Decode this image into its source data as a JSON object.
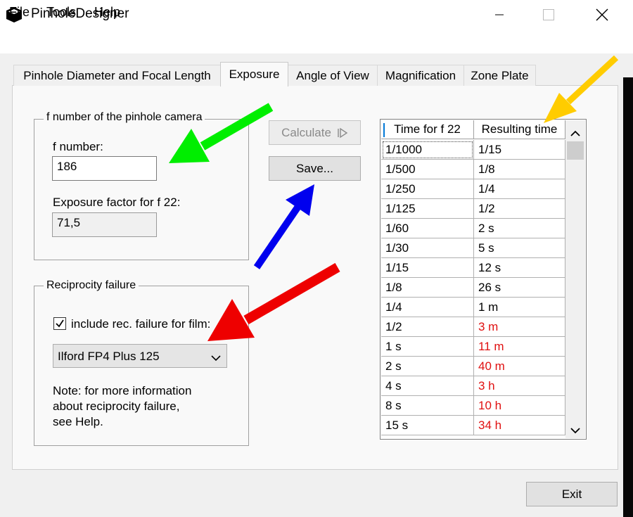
{
  "window": {
    "title": "PinholeDesigner"
  },
  "menu": {
    "file": "File",
    "tools": "Tools",
    "help": "Help"
  },
  "tabs": [
    {
      "label": "Pinhole Diameter and Focal Length"
    },
    {
      "label": "Exposure"
    },
    {
      "label": "Angle of View"
    },
    {
      "label": "Magnification"
    },
    {
      "label": "Zone Plate"
    }
  ],
  "fnumber_group": {
    "legend": "f number of the pinhole camera",
    "fnumber_label": "f number:",
    "fnumber_value": "186",
    "factor_label": "Exposure factor for f 22:",
    "factor_value": "71,5"
  },
  "buttons": {
    "calculate": "Calculate",
    "save": "Save...",
    "exit": "Exit"
  },
  "reciprocity_group": {
    "legend": "Reciprocity failure",
    "checkbox_label": "include rec. failure for film:",
    "checked": true,
    "film_selected": "Ilford FP4 Plus 125",
    "note_line1": "Note: for more information",
    "note_line2": "about reciprocity failure,",
    "note_line3": "see Help."
  },
  "table": {
    "headers": [
      "Time for f 22",
      "Resulting time"
    ],
    "rows": [
      {
        "time": "1/1000",
        "result": "1/15",
        "warning": false
      },
      {
        "time": "1/500",
        "result": "1/8",
        "warning": false
      },
      {
        "time": "1/250",
        "result": "1/4",
        "warning": false
      },
      {
        "time": "1/125",
        "result": "1/2",
        "warning": false
      },
      {
        "time": "1/60",
        "result": "2 s",
        "warning": false
      },
      {
        "time": "1/30",
        "result": "5 s",
        "warning": false
      },
      {
        "time": "1/15",
        "result": "12 s",
        "warning": false
      },
      {
        "time": "1/8",
        "result": "26 s",
        "warning": false
      },
      {
        "time": "1/4",
        "result": "1 m",
        "warning": false
      },
      {
        "time": "1/2",
        "result": "3 m",
        "warning": true
      },
      {
        "time": "1 s",
        "result": "11 m",
        "warning": true
      },
      {
        "time": "2 s",
        "result": "40 m",
        "warning": true
      },
      {
        "time": "4 s",
        "result": "3 h",
        "warning": true
      },
      {
        "time": "8 s",
        "result": "10 h",
        "warning": true
      },
      {
        "time": "15 s",
        "result": "34 h",
        "warning": true
      }
    ]
  },
  "colors": {
    "warning_text": "#e01010",
    "arrow_green": "#00ee00",
    "arrow_yellow": "#ffcc00",
    "arrow_blue": "#0000ee",
    "arrow_red": "#ee0000"
  }
}
